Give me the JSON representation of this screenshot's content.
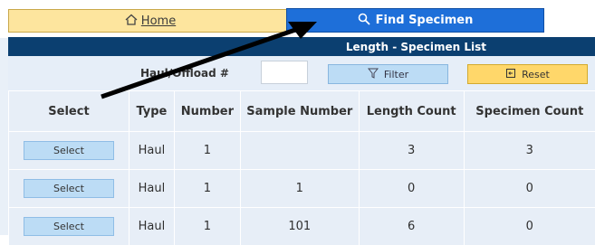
{
  "nav": {
    "home_label": "Home",
    "find_label": "Find Specimen"
  },
  "panel": {
    "title": "Length - Specimen List",
    "haul_offload_label": "Haul/Offload #",
    "haul_offload_value": "",
    "filter_label": "Filter",
    "reset_label": "Reset"
  },
  "table": {
    "headers": [
      "Select",
      "Type",
      "Number",
      "Sample Number",
      "Length Count",
      "Specimen Count"
    ],
    "rows": [
      {
        "select": "Select",
        "type": "Haul",
        "number": "1",
        "sample_number": "",
        "length_count": "3",
        "specimen_count": "3"
      },
      {
        "select": "Select",
        "type": "Haul",
        "number": "1",
        "sample_number": "1",
        "length_count": "0",
        "specimen_count": "0"
      },
      {
        "select": "Select",
        "type": "Haul",
        "number": "1",
        "sample_number": "101",
        "length_count": "6",
        "specimen_count": "0"
      }
    ]
  },
  "colors": {
    "home_bg": "#fde59e",
    "find_bg": "#1e6fd9",
    "title_bar": "#0b3f70",
    "filter_bg": "#bcdcf5",
    "reset_bg": "#ffd76a",
    "annotation_arrow": "#000000"
  },
  "icons": {
    "home": "home-icon",
    "find": "search-icon",
    "filter": "filter-icon",
    "reset": "reset-icon"
  }
}
